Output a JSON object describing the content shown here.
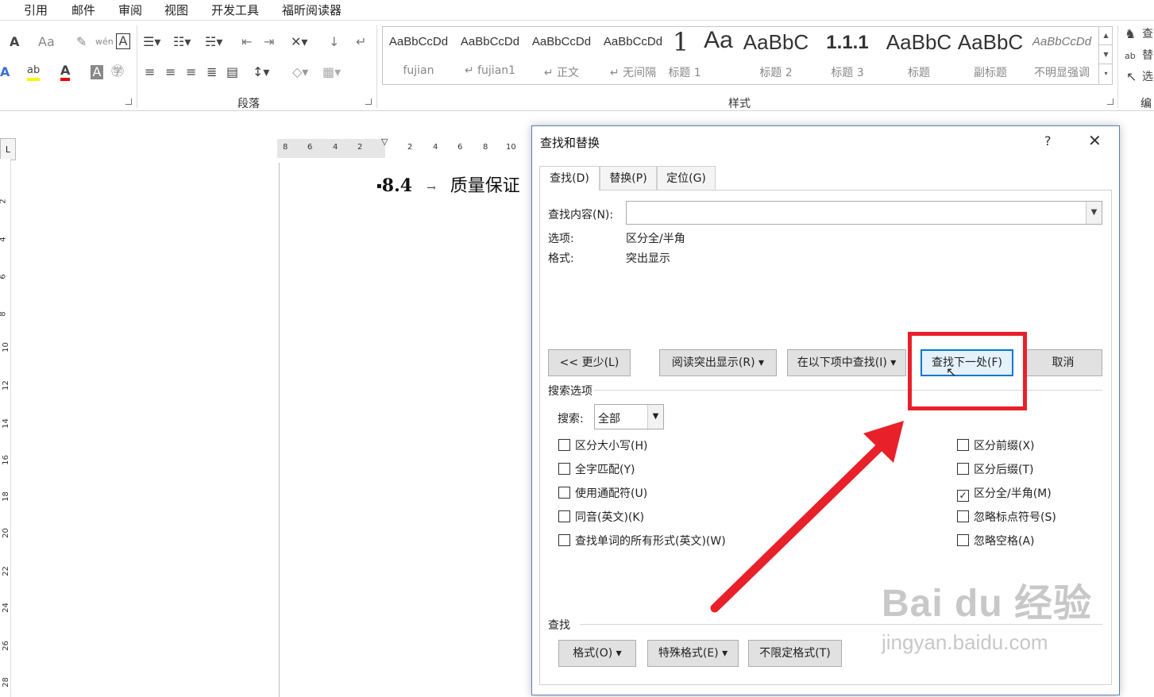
{
  "menu": [
    "引用",
    "邮件",
    "审阅",
    "视图",
    "开发工具",
    "福昕阅读器"
  ],
  "ribbon": {
    "group_paragraph": "段落",
    "group_styles": "样式",
    "group_edit_partial": "编",
    "font_case_label": "Aa",
    "font_wen_label": "wén",
    "right_find": "查",
    "right_replace": "替",
    "right_select": "选",
    "styles": [
      {
        "sample": "AaBbCcDd",
        "name": "fujian"
      },
      {
        "sample": "AaBbCcDd",
        "name": "↵ fujian1"
      },
      {
        "sample": "AaBbCcDd",
        "name": "↵ 正文"
      },
      {
        "sample": "AaBbCcDd",
        "name": "↵ 无间隔"
      },
      {
        "sample": "1",
        "name": "标题 1"
      },
      {
        "sample": "Aa",
        "name": "标题 2"
      },
      {
        "sample": "AaBbC",
        "name": "标题 2"
      },
      {
        "sample": "1.1.1",
        "name": "标题 3"
      },
      {
        "sample": "AaBbC",
        "name": "标题"
      },
      {
        "sample": "AaBbC",
        "name": "副标题"
      },
      {
        "sample": "AaBbCcDd",
        "name": "不明显强调"
      }
    ]
  },
  "ruler": {
    "horizontal": [
      "8",
      "6",
      "4",
      "2",
      "2",
      "4",
      "6",
      "8",
      "10"
    ],
    "vertical": [
      "2",
      "4",
      "6",
      "8",
      "10",
      "12",
      "14",
      "16",
      "18",
      "20",
      "22",
      "24",
      "26",
      "28"
    ]
  },
  "document": {
    "heading_number": "8.4",
    "heading_arrow": "→",
    "heading_text": "质量保证"
  },
  "dialog": {
    "title": "查找和替换",
    "help": "?",
    "close": "✕",
    "tabs": [
      "查找(D)",
      "替换(P)",
      "定位(G)"
    ],
    "find_label": "查找内容(N):",
    "find_value": "",
    "options_label": "选项:",
    "options_value": "区分全/半角",
    "format_label": "格式:",
    "format_value": "突出显示",
    "buttons": {
      "less": "<< 更少(L)",
      "reading_highlight": "阅读突出显示(R) ▾",
      "find_in": "在以下项中查找(I) ▾",
      "find_next": "查找下一处(F)",
      "cancel": "取消"
    },
    "search_options_label": "搜索选项",
    "search_label": "搜索:",
    "search_value": "全部",
    "checkboxes_left": [
      {
        "label": "区分大小写(H)",
        "checked": false
      },
      {
        "label": "全字匹配(Y)",
        "checked": false
      },
      {
        "label": "使用通配符(U)",
        "checked": false
      },
      {
        "label": "同音(英文)(K)",
        "checked": false
      },
      {
        "label": "查找单词的所有形式(英文)(W)",
        "checked": false
      }
    ],
    "checkboxes_right": [
      {
        "label": "区分前缀(X)",
        "checked": false
      },
      {
        "label": "区分后缀(T)",
        "checked": false
      },
      {
        "label": "区分全/半角(M)",
        "checked": true
      },
      {
        "label": "忽略标点符号(S)",
        "checked": false
      },
      {
        "label": "忽略空格(A)",
        "checked": false
      }
    ],
    "find_section_label": "查找",
    "bottom_buttons": {
      "format": "格式(O) ▾",
      "special": "特殊格式(E) ▾",
      "no_format": "不限定格式(T)"
    }
  },
  "watermark": {
    "big": "Bai du 经验",
    "small": "jingyan.baidu.com"
  },
  "colors": {
    "annotation_red": "#e8202a",
    "dialog_border": "#5a7fb5",
    "primary_button_border": "#0078d7"
  }
}
